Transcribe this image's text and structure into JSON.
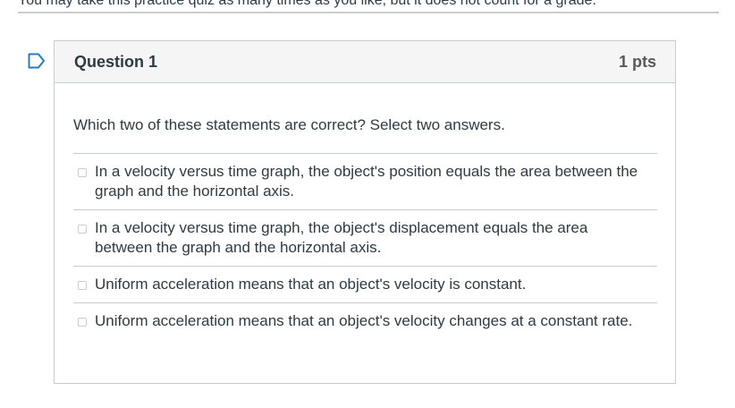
{
  "intro_text": "You may take this practice quiz as many times as you like, but it does not count for a grade.",
  "question": {
    "title": "Question 1",
    "points": "1 pts",
    "text": "Which two of these statements are correct? Select two answers.",
    "flag_icon": "bookmark-flag-outline",
    "answers": [
      {
        "label": "In a velocity versus time graph, the object's position equals the area between the graph and the horizontal axis.",
        "checked": false
      },
      {
        "label": "In a velocity versus time graph, the object's displacement equals the area between the graph and the horizontal axis.",
        "checked": false
      },
      {
        "label": "Uniform acceleration means that an object's velocity is constant.",
        "checked": false
      },
      {
        "label": "Uniform acceleration means that an object's velocity changes at a constant rate.",
        "checked": false
      }
    ]
  },
  "colors": {
    "flag": "#2b7abc",
    "border": "#c7cdd1",
    "header_bg": "#f5f5f5",
    "text": "#2d3b45"
  }
}
